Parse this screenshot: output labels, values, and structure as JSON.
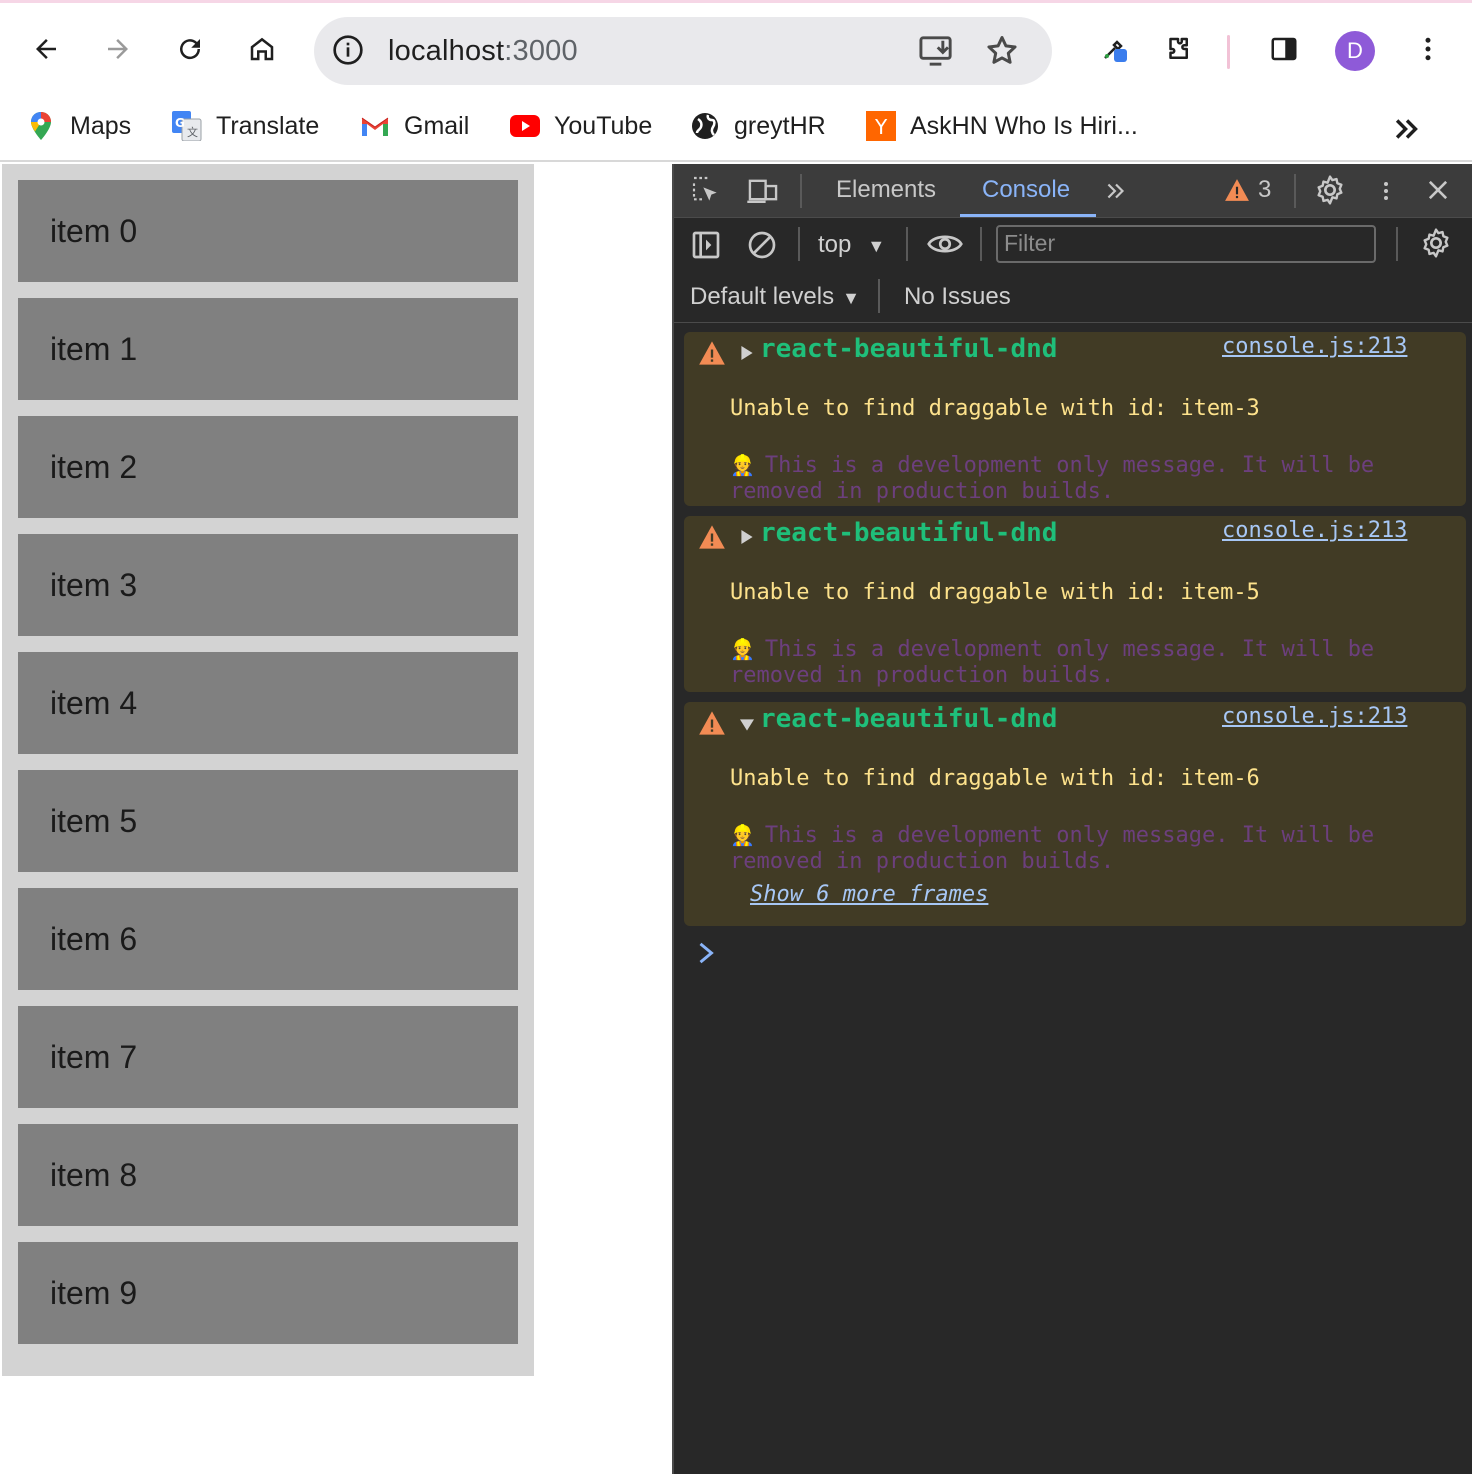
{
  "browser": {
    "url_host": "localhost",
    "url_port": ":3000",
    "profile_initial": "D",
    "icons": [
      "back-icon",
      "forward-icon",
      "reload-icon",
      "home-icon",
      "site-info-icon",
      "install-app-icon",
      "bookmark-star-icon",
      "eyedropper-extension-icon",
      "extensions-puzzle-icon",
      "side-panel-icon",
      "kebab-menu-icon"
    ]
  },
  "bookmarks": [
    {
      "label": "Maps",
      "icon": "maps-pin-icon"
    },
    {
      "label": "Translate",
      "icon": "translate-icon"
    },
    {
      "label": "Gmail",
      "icon": "gmail-icon"
    },
    {
      "label": "YouTube",
      "icon": "youtube-icon"
    },
    {
      "label": "greytHR",
      "icon": "globe-icon"
    },
    {
      "label": "AskHN Who Is Hiri...",
      "icon": "hackernews-icon"
    }
  ],
  "list": {
    "items": [
      "item 0",
      "item 1",
      "item 2",
      "item 3",
      "item 4",
      "item 5",
      "item 6",
      "item 7",
      "item 8",
      "item 9"
    ]
  },
  "devtools": {
    "tabs": [
      "Elements",
      "Console"
    ],
    "active_tab": "Console",
    "warning_count": "3",
    "context": "top",
    "filter_placeholder": "Filter",
    "levels": "Default levels",
    "issues": "No Issues",
    "messages": [
      {
        "source": "react-beautiful-dnd",
        "link": "console.js:213",
        "text": "Unable to find draggable with id: item-3",
        "dev_note": "This is a development only message. It will be removed in production builds.",
        "expanded": false
      },
      {
        "source": "react-beautiful-dnd",
        "link": "console.js:213",
        "text": "Unable to find draggable with id: item-5",
        "dev_note": "This is a development only message. It will be removed in production builds.",
        "expanded": false
      },
      {
        "source": "react-beautiful-dnd",
        "link": "console.js:213",
        "text": "Unable to find draggable with id: item-6",
        "dev_note": "This is a development only message. It will be removed in production builds.",
        "expanded": true,
        "more": "Show 6 more frames"
      }
    ],
    "colors": {
      "warning_bg": "#413b25",
      "source_green": "#1fbf7a",
      "message_yellow": "#fde28c",
      "link_blue": "#a7c7f5",
      "active_tab_blue": "#8ab4f8"
    }
  }
}
